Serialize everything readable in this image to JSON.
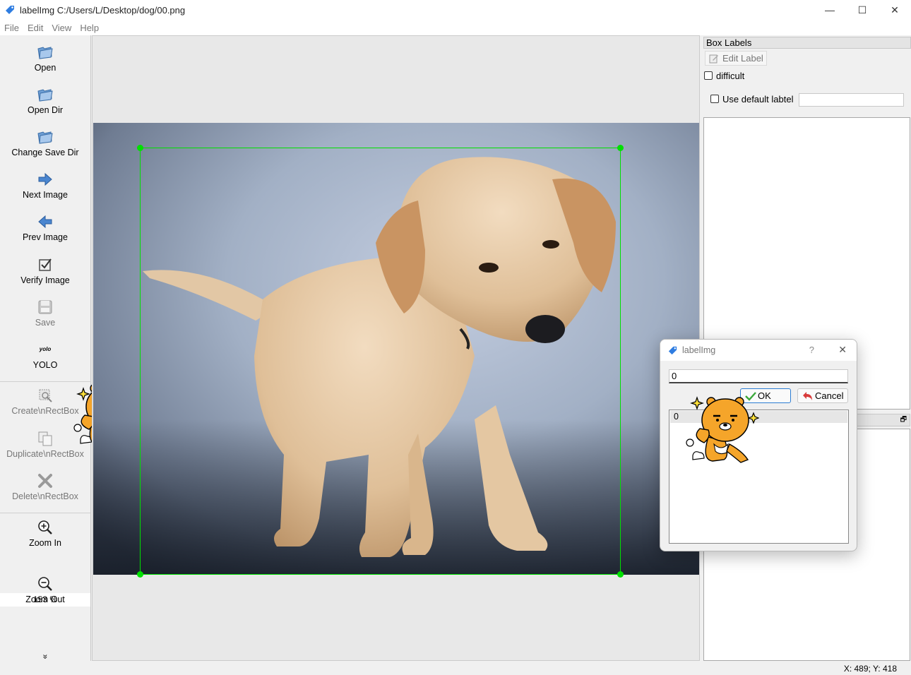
{
  "window": {
    "title": "labelImg C:/Users/L/Desktop/dog/00.png",
    "controls": {
      "minimize": "—",
      "maximize": "☐",
      "close": "✕"
    }
  },
  "menu": [
    "File",
    "Edit",
    "View",
    "Help"
  ],
  "toolbar": {
    "open": "Open",
    "open_dir": "Open Dir",
    "change_save_dir": "Change Save Dir",
    "next_image": "Next Image",
    "prev_image": "Prev Image",
    "verify_image": "Verify Image",
    "save": "Save",
    "yolo_icon_text": "yolo",
    "yolo": "YOLO",
    "create_rect": "Create\\nRectBox",
    "duplicate_rect": "Duplicate\\nRectBox",
    "delete_rect": "Delete\\nRectBox",
    "zoom_in": "Zoom In",
    "zoom_value": "153 %",
    "zoom_out": "Zoom Out",
    "more": "»"
  },
  "right_panel": {
    "title": "Box Labels",
    "edit_label": "Edit Label",
    "difficult": "difficult",
    "use_default_label": "Use default labtel",
    "default_label_value": ""
  },
  "status": {
    "coords": "X: 489; Y: 418"
  },
  "dialog": {
    "title": "labelImg",
    "help": "?",
    "close": "✕",
    "input_value": "0",
    "ok": "OK",
    "cancel": "Cancel",
    "list_items": [
      "0"
    ]
  },
  "colors": {
    "bbox": "#00e000",
    "accent": "#2b7cd3"
  }
}
